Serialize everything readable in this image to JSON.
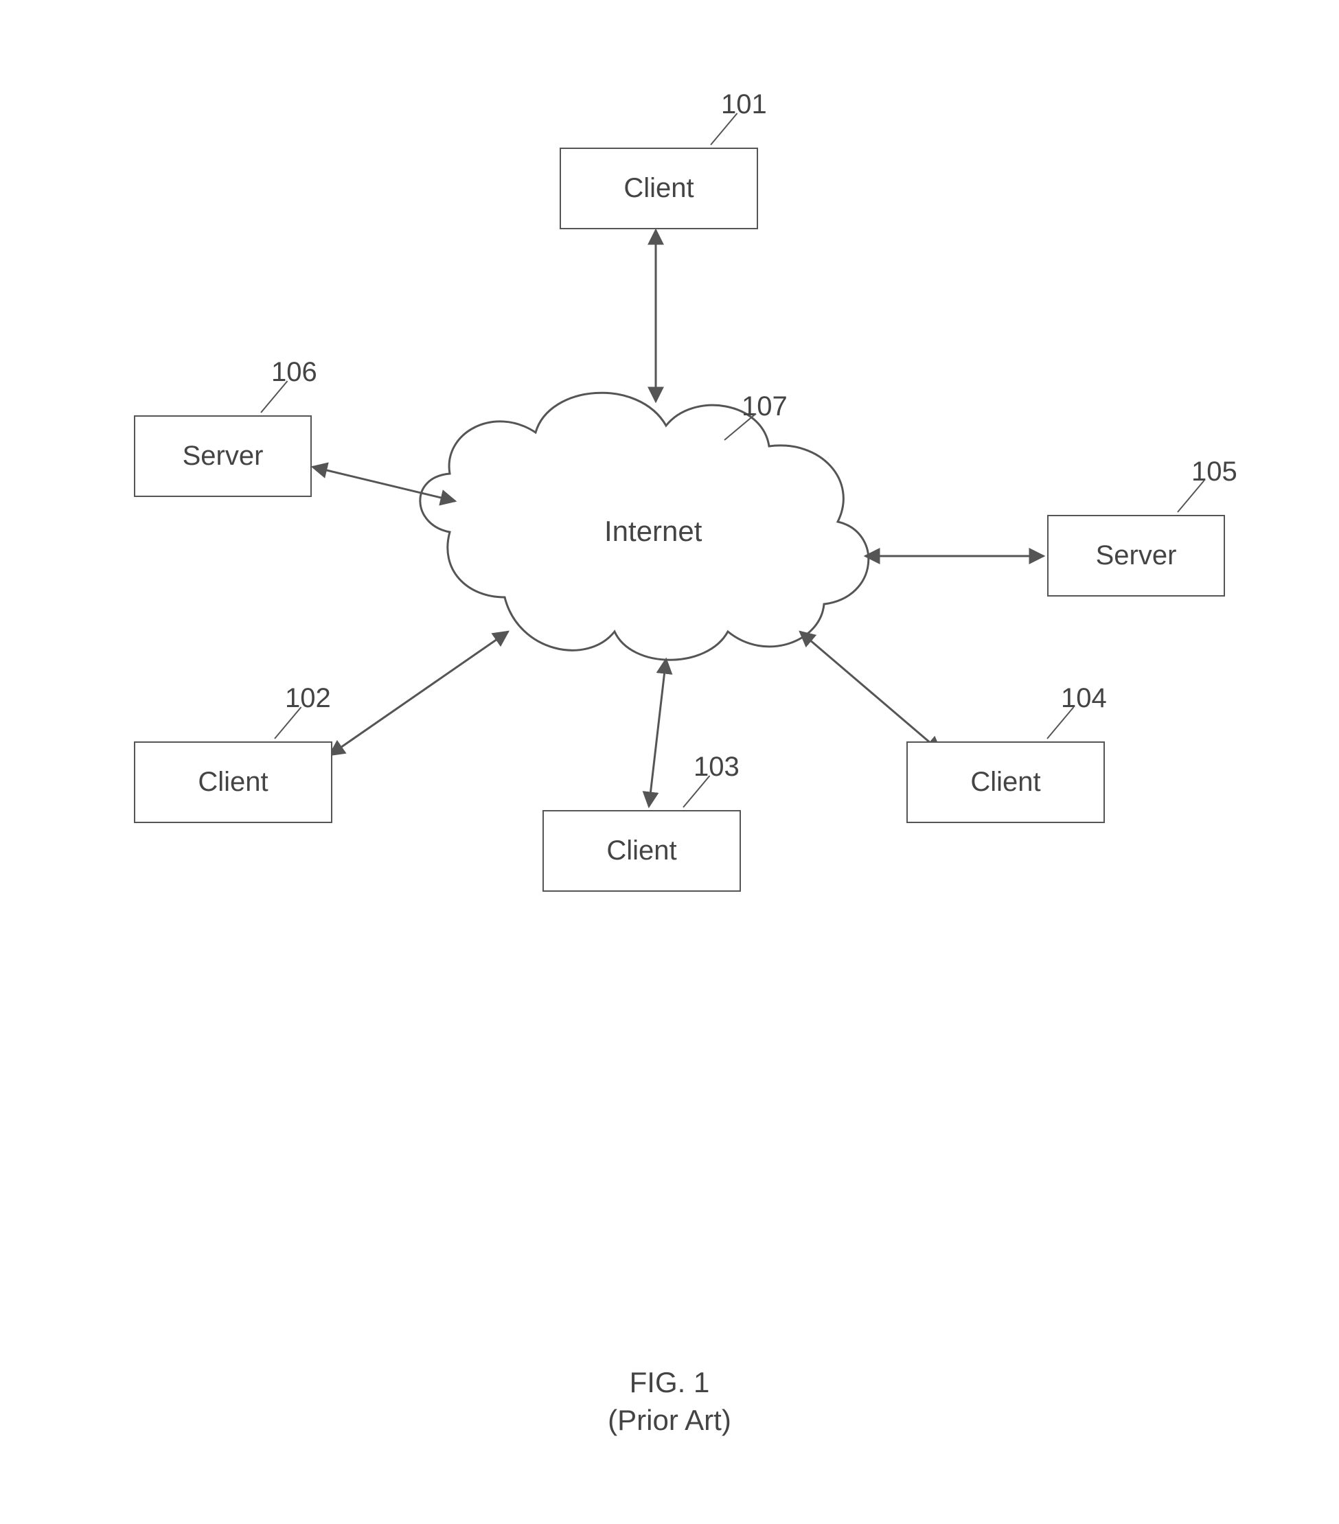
{
  "nodes": {
    "client_top": {
      "label": "Client",
      "ref": "101"
    },
    "client_bl": {
      "label": "Client",
      "ref": "102"
    },
    "client_bc": {
      "label": "Client",
      "ref": "103"
    },
    "client_br": {
      "label": "Client",
      "ref": "104"
    },
    "server_right": {
      "label": "Server",
      "ref": "105"
    },
    "server_left": {
      "label": "Server",
      "ref": "106"
    },
    "cloud": {
      "label": "Internet",
      "ref": "107"
    }
  },
  "caption": {
    "line1": "FIG. 1",
    "line2": "(Prior Art)"
  }
}
